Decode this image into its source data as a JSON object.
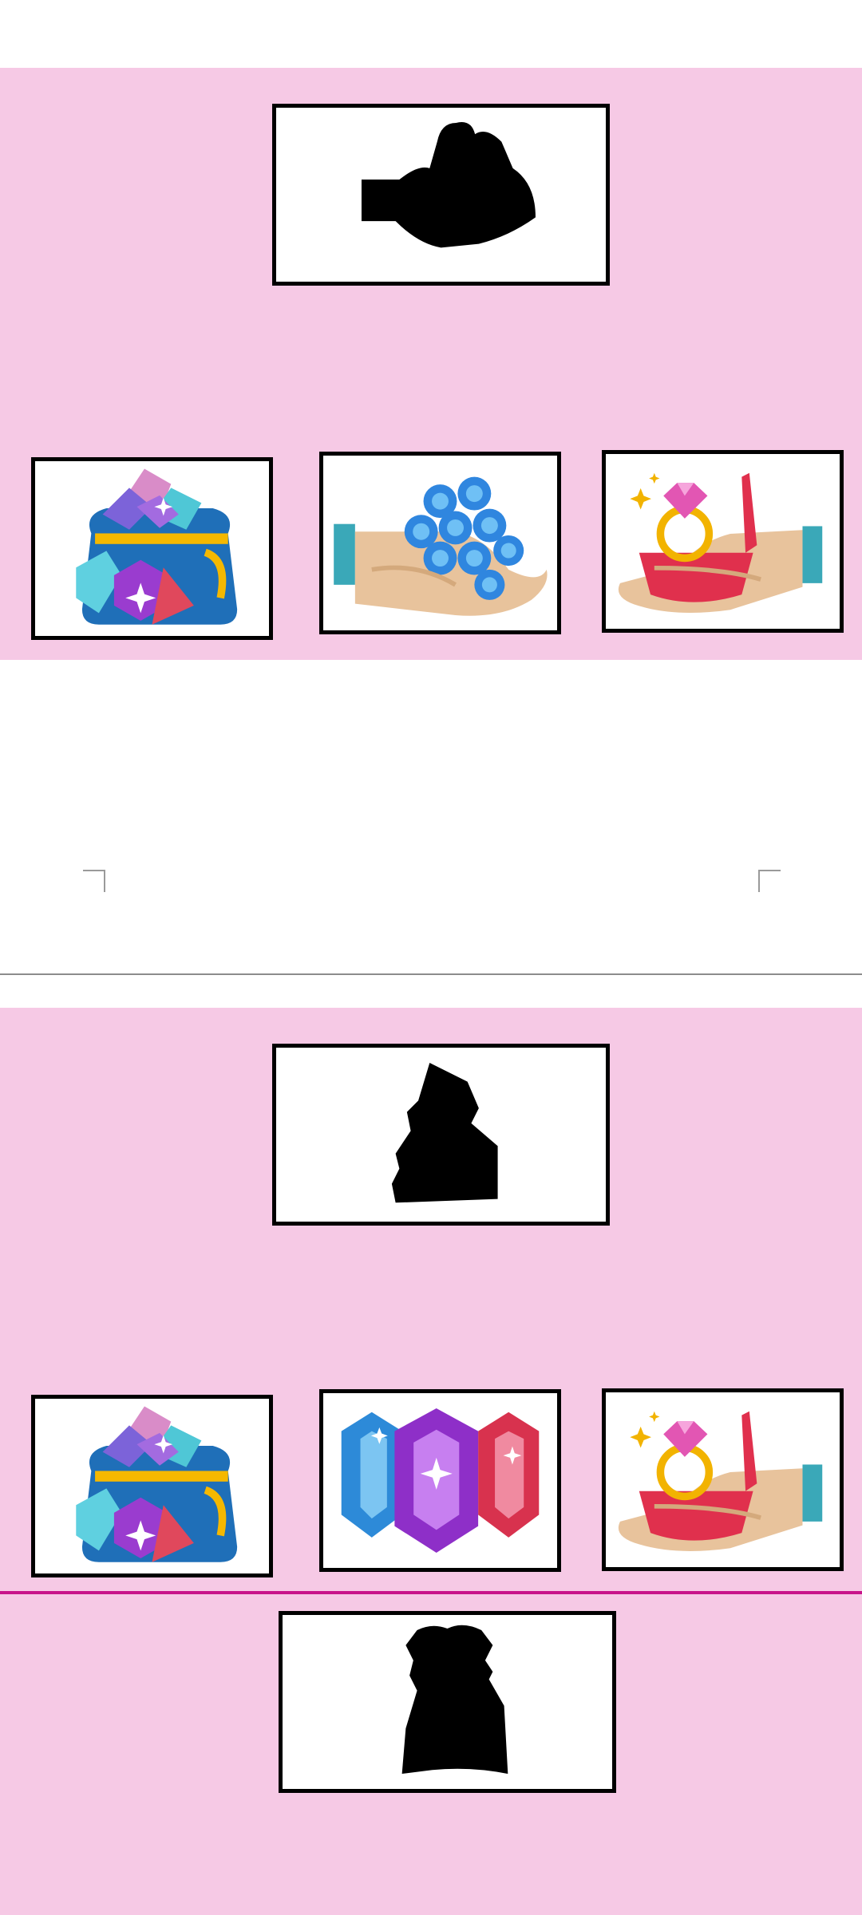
{
  "colors": {
    "panel_background": "#f6c9e5",
    "card_border": "#000000",
    "divider_accent": "#c8138a",
    "divider_grey": "#8c8c8c"
  },
  "puzzles": [
    {
      "target": "hand-gems-silhouette",
      "choices": [
        "gem-bag-icon",
        "hand-blue-gems-icon",
        "hand-ring-box-icon"
      ]
    },
    {
      "target": "gem-bag-silhouette",
      "choices": [
        "gem-bag-icon",
        "three-gems-icon",
        "hand-ring-box-icon"
      ]
    },
    {
      "target": "ring-box-silhouette",
      "choices": []
    }
  ]
}
